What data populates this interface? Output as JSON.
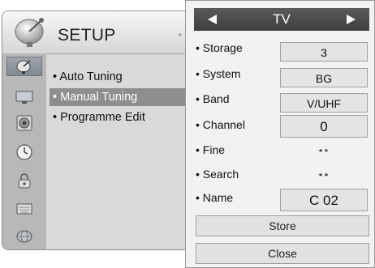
{
  "setup": {
    "title": "SETUP",
    "indicator": "◂",
    "menu_items": [
      "Auto Tuning",
      "Manual Tuning",
      "Programme Edit"
    ]
  },
  "icons": [
    "satellite-dish-icon",
    "tv-monitor-icon",
    "speaker-icon",
    "clock-icon",
    "lock-icon",
    "keyboard-icon",
    "globe-icon"
  ],
  "tuning": {
    "source": "TV",
    "rows": [
      {
        "label": "Storage",
        "value": "3"
      },
      {
        "label": "System",
        "value": "BG"
      },
      {
        "label": "Band",
        "value": "V/UHF"
      },
      {
        "label": "Channel",
        "value": "0"
      },
      {
        "label": "Fine",
        "value": "◂ ▸"
      },
      {
        "label": "Search",
        "value": "◂ ▸"
      },
      {
        "label": "Name",
        "value": "C 02"
      }
    ],
    "store_label": "Store",
    "close_label": "Close"
  },
  "colors": {
    "panel_bg": "#f2f2f2",
    "menu_bg": "#d9d9d9",
    "selection": "#8e8e8e",
    "source_bar": "#4a4a4a"
  }
}
